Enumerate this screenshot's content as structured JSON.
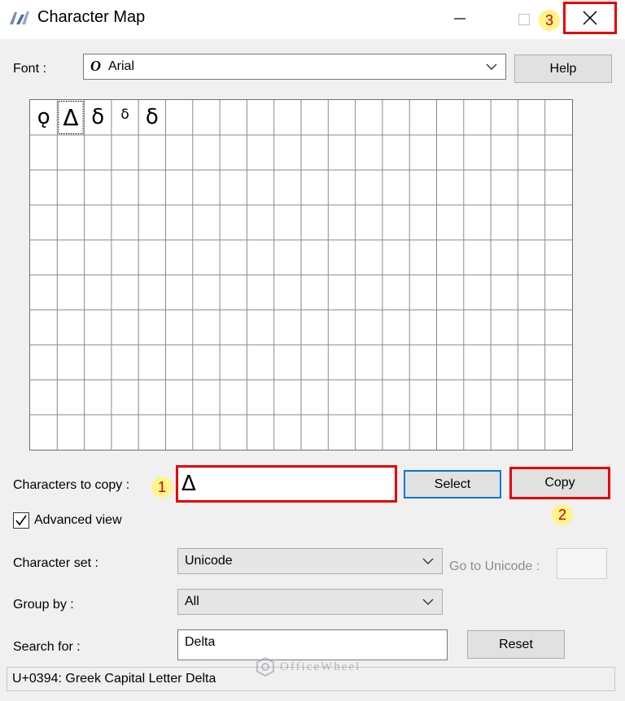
{
  "window": {
    "title": "Character Map",
    "minimize_icon": "minimize-icon",
    "maximize_icon": "maximize-icon",
    "close_icon": "close-icon"
  },
  "annotations": {
    "step1": "1",
    "step2": "2",
    "step3": "3",
    "highlight_color": "#e60000",
    "badge_color": "#fff48a"
  },
  "font": {
    "label": "Font :",
    "value": "Arial",
    "icon": "font-type-icon"
  },
  "help_label": "Help",
  "grid": {
    "rows": 10,
    "cols": 20,
    "chars": [
      "ǫ",
      "Δ",
      "δ",
      "δ",
      "δ"
    ],
    "selected_index": 1
  },
  "copy": {
    "label": "Characters to copy :",
    "value": "Δ",
    "select_label": "Select",
    "copy_label": "Copy"
  },
  "advanced_view": {
    "label": "Advanced view",
    "checked": true
  },
  "character_set": {
    "label": "Character set :",
    "value": "Unicode"
  },
  "go_to_unicode": {
    "label": "Go to Unicode :",
    "value": ""
  },
  "group_by": {
    "label": "Group by :",
    "value": "All"
  },
  "search": {
    "label": "Search for :",
    "value": "Delta",
    "reset_label": "Reset"
  },
  "status": "U+0394: Greek Capital Letter Delta",
  "watermark": "OfficeWheel"
}
